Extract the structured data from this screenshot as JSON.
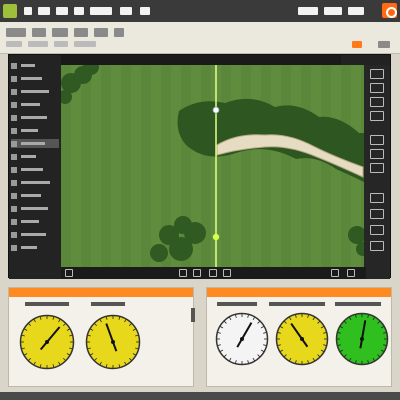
{
  "colors": {
    "accent": "#ff7a1a",
    "grass": "#5d8a3c",
    "fairway": "#6e9b45",
    "gauge_yellow": "#e8d81c",
    "gauge_white": "#f4f4f4",
    "gauge_green": "#2fbf1f"
  },
  "left_tools": [
    {
      "icon": "arrow-icon"
    },
    {
      "icon": "marker-icon"
    },
    {
      "icon": "line-icon"
    },
    {
      "icon": "circle-icon"
    },
    {
      "icon": "target-icon"
    },
    {
      "icon": "grid-icon"
    },
    {
      "icon": "layer-icon"
    },
    {
      "icon": "flag-icon"
    },
    {
      "icon": "ruler-icon"
    },
    {
      "icon": "tree-icon"
    },
    {
      "icon": "bunker-icon"
    },
    {
      "icon": "water-icon"
    },
    {
      "icon": "camera-icon"
    },
    {
      "icon": "settings-icon"
    },
    {
      "icon": "info-icon"
    }
  ],
  "gauges_left": [
    {
      "color": "#e8d81c",
      "needle_deg": 40,
      "icon": "wind-dial-icon"
    },
    {
      "color": "#e8d81c",
      "needle_deg": -20,
      "icon": "direction-dial-icon"
    }
  ],
  "gauges_right": [
    {
      "color": "#f4f4f4",
      "needle_deg": 30,
      "icon": "slope-dial-icon"
    },
    {
      "color": "#e8d81c",
      "needle_deg": -35,
      "icon": "speed-dial-icon"
    },
    {
      "color": "#2fbf1f",
      "needle_deg": 10,
      "icon": "green-dial-icon"
    }
  ]
}
